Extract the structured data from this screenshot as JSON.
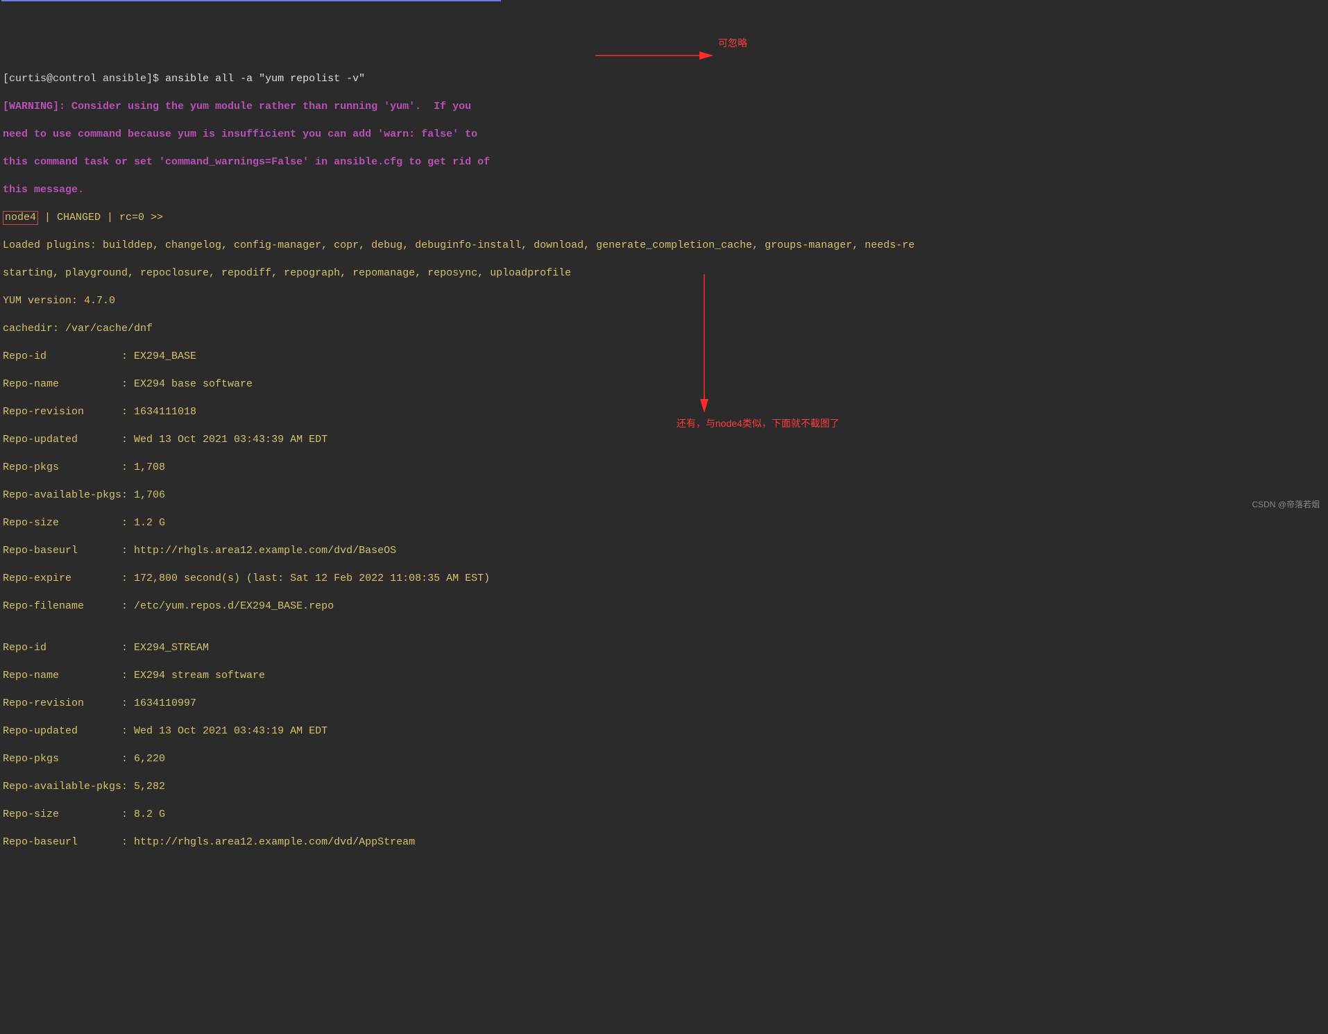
{
  "prompt": {
    "user_host_path": "[curtis@control ansible]$",
    "command": "ansible all -a \"yum repolist -v\""
  },
  "warning": {
    "line1": "[WARNING]: Consider using the yum module rather than running 'yum'.  If you",
    "line2": "need to use command because yum is insufficient you can add 'warn: false' to",
    "line3": "this command task or set 'command_warnings=False' in ansible.cfg to get rid of",
    "line4": "this message."
  },
  "status": {
    "node": "node4",
    "rest": " | CHANGED | rc=0 >>"
  },
  "output": {
    "plugins_line1": "Loaded plugins: builddep, changelog, config-manager, copr, debug, debuginfo-install, download, generate_completion_cache, groups-manager, needs-re",
    "plugins_line2": "starting, playground, repoclosure, repodiff, repograph, repomanage, reposync, uploadprofile",
    "yum_version": "YUM version: 4.7.0",
    "cachedir": "cachedir: /var/cache/dnf",
    "repo1": {
      "id": "Repo-id            : EX294_BASE",
      "name": "Repo-name          : EX294 base software",
      "revision": "Repo-revision      : 1634111018",
      "updated": "Repo-updated       : Wed 13 Oct 2021 03:43:39 AM EDT",
      "pkgs": "Repo-pkgs          : 1,708",
      "available": "Repo-available-pkgs: 1,706",
      "size": "Repo-size          : 1.2 G",
      "baseurl": "Repo-baseurl       : http://rhgls.area12.example.com/dvd/BaseOS",
      "expire": "Repo-expire        : 172,800 second(s) (last: Sat 12 Feb 2022 11:08:35 AM EST)",
      "filename": "Repo-filename      : /etc/yum.repos.d/EX294_BASE.repo"
    },
    "blank": "",
    "repo2": {
      "id": "Repo-id            : EX294_STREAM",
      "name": "Repo-name          : EX294 stream software",
      "revision": "Repo-revision      : 1634110997",
      "updated": "Repo-updated       : Wed 13 Oct 2021 03:43:19 AM EDT",
      "pkgs": "Repo-pkgs          : 6,220",
      "available": "Repo-available-pkgs: 5,282",
      "size": "Repo-size          : 8.2 G",
      "baseurl": "Repo-baseurl       : http://rhgls.area12.example.com/dvd/AppStream"
    }
  },
  "annotations": {
    "top": "可忽略",
    "bottom": "还有，与node4类似，下面就不截图了"
  },
  "watermark": "CSDN @帝落若烟"
}
